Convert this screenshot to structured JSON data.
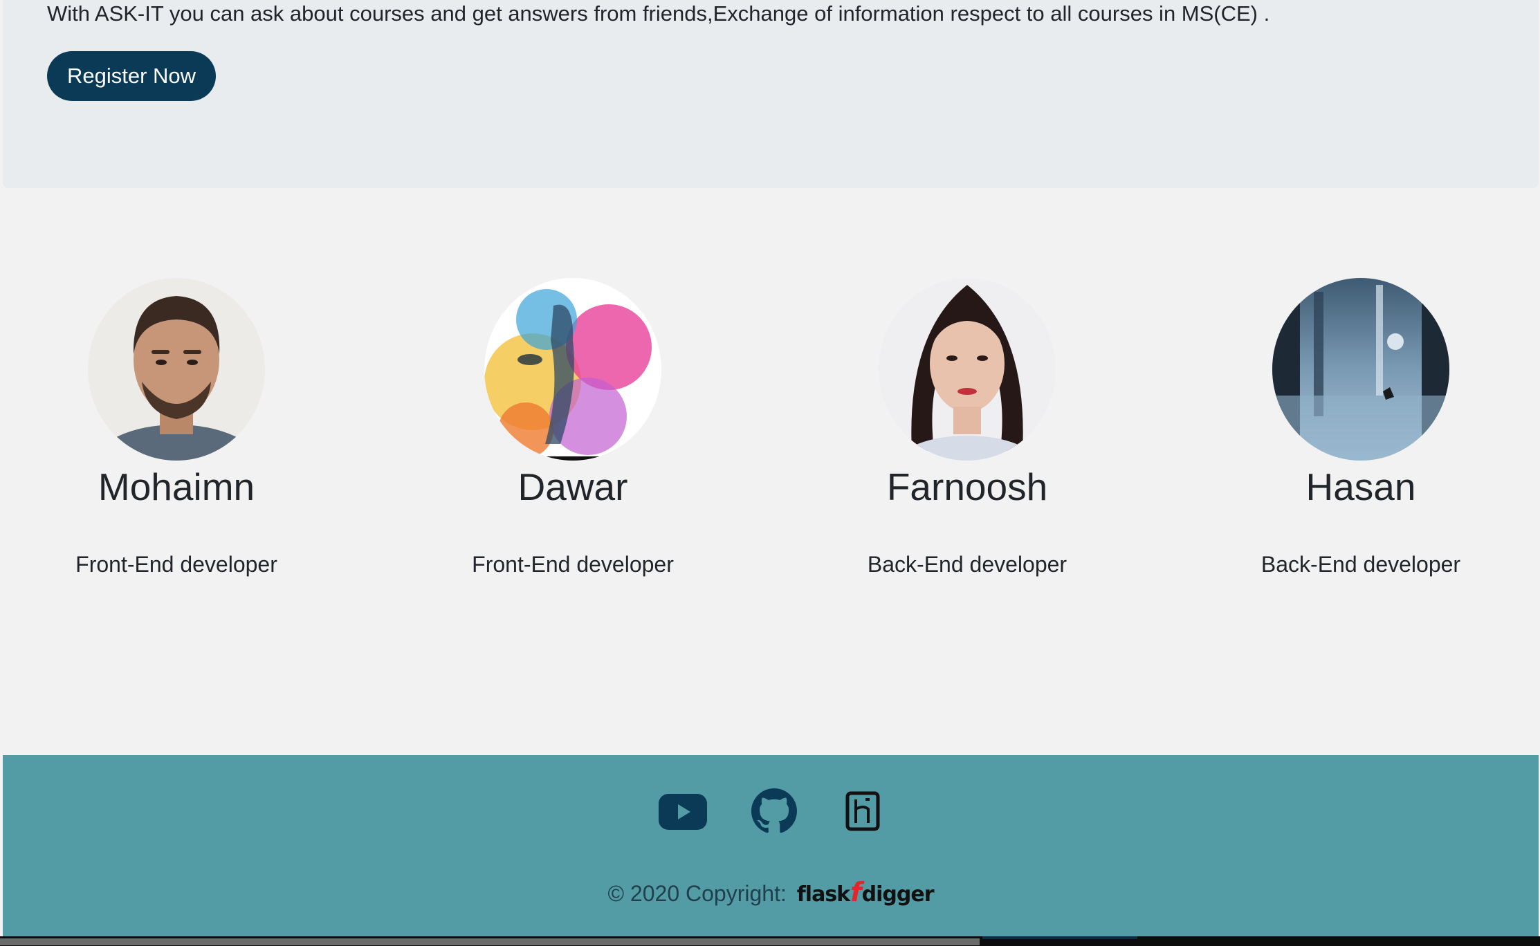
{
  "hero": {
    "description": "With ASK-IT you can ask about courses and get answers from friends,Exchange of information respect to all courses in MS(CE) .",
    "register_label": "Register Now"
  },
  "team": [
    {
      "name": "Mohaimn",
      "role": "Front-End developer"
    },
    {
      "name": "Dawar",
      "role": "Front-End developer"
    },
    {
      "name": "Farnoosh",
      "role": "Back-End developer"
    },
    {
      "name": "Hasan",
      "role": "Back-End developer"
    }
  ],
  "footer": {
    "social_icons": [
      "youtube-icon",
      "github-icon",
      "heroku-icon"
    ],
    "copyright_text": "© 2020 Copyright:",
    "brand_part1": "flask",
    "brand_mark": "f",
    "brand_part2": "digger"
  },
  "colors": {
    "hero_bg": "#e9ecef",
    "button_bg": "#0b3a57",
    "page_bg": "#f2f2f2",
    "footer_bg": "#539ca5",
    "icon_color": "#0b3a57",
    "brand_accent": "#e3262c"
  }
}
